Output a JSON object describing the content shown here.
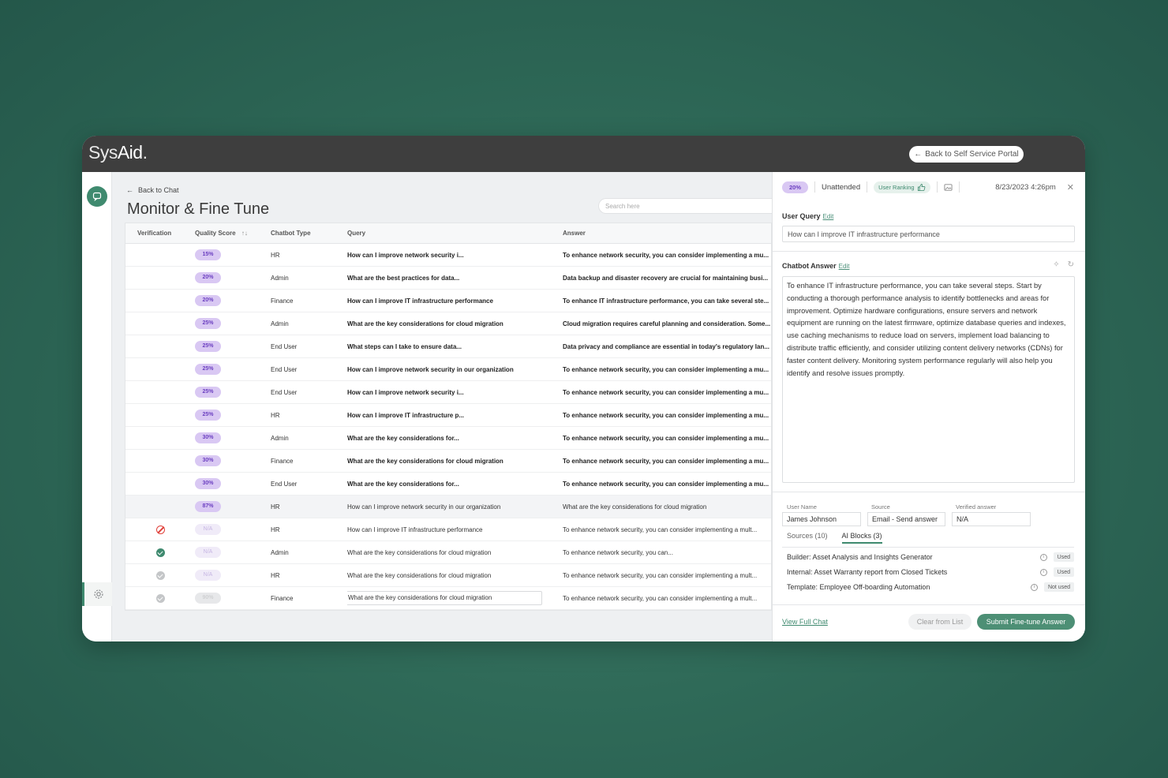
{
  "app": {
    "logo_prefix": "Sys",
    "logo_suffix": "Aid",
    "logo_dot": ".",
    "portal_button": "Back to Self Service Portal"
  },
  "nav": {
    "back_label": "Back to Chat",
    "page_title": "Monitor & Fine Tune",
    "search_placeholder": "Search here"
  },
  "table": {
    "headers": {
      "verification": "Verification",
      "quality": "Quality Score",
      "sort_glyph": "↑↓",
      "type": "Chatbot Type",
      "query": "Query",
      "answer": "Answer"
    },
    "rows": [
      {
        "verification": "",
        "score": "15%",
        "type": "HR",
        "query": "How can I improve network security i...",
        "answer": "To enhance network security, you can consider implementing a mu..."
      },
      {
        "verification": "",
        "score": "20%",
        "type": "Admin",
        "query": "What are the best practices for data...",
        "answer": "Data backup and disaster recovery are crucial for maintaining busi..."
      },
      {
        "verification": "",
        "score": "20%",
        "type": "Finance",
        "query": "How can I improve IT infrastructure performance",
        "answer": "To enhance IT infrastructure performance, you can take several ste..."
      },
      {
        "verification": "",
        "score": "25%",
        "type": "Admin",
        "query": "What are the key considerations for cloud migration",
        "answer": "Cloud migration requires careful planning and consideration. Some..."
      },
      {
        "verification": "",
        "score": "25%",
        "type": "End User",
        "query": "What steps can I take to ensure data...",
        "answer": "Data privacy and compliance are essential in today's regulatory lan..."
      },
      {
        "verification": "",
        "score": "25%",
        "type": "End User",
        "query": "How can I improve network security in our organization",
        "answer": "To enhance network security, you can consider implementing a mu..."
      },
      {
        "verification": "",
        "score": "25%",
        "type": "End User",
        "query": "How can I improve network security i...",
        "answer": "To enhance network security, you can consider implementing a mu..."
      },
      {
        "verification": "",
        "score": "25%",
        "type": "HR",
        "query": "How can I improve IT infrastructure p...",
        "answer": "To enhance network security, you can consider implementing a mu..."
      },
      {
        "verification": "",
        "score": "30%",
        "type": "Admin",
        "query": "What are the key considerations for...",
        "answer": "To enhance network security, you can consider implementing a mu..."
      },
      {
        "verification": "",
        "score": "30%",
        "type": "Finance",
        "query": "What are the key considerations for cloud migration",
        "answer": "To enhance network security, you can consider implementing a mu..."
      },
      {
        "verification": "",
        "score": "30%",
        "type": "End User",
        "query": "What are the key considerations for...",
        "answer": "To enhance network security, you can consider implementing a mu..."
      },
      {
        "verification": "",
        "score": "87%",
        "type": "HR",
        "query": "How can I improve network security in our organization",
        "answer": "What are the key considerations for cloud migration"
      },
      {
        "verification": "blocked",
        "score": "N/A",
        "type": "HR",
        "query": "How can I improve IT infrastructure performance",
        "answer": "To enhance network security, you can consider implementing a mult..."
      },
      {
        "verification": "verified",
        "score": "N/A",
        "type": "Admin",
        "query": "What are the key considerations for cloud migration",
        "answer": "To enhance network security, you can..."
      },
      {
        "verification": "pending",
        "score": "N/A",
        "type": "HR",
        "query": "What are the key considerations for cloud migration",
        "answer": "To enhance network security, you can consider implementing a mult..."
      },
      {
        "verification": "pending",
        "score": "90%",
        "type": "Finance",
        "query": "What are the key considerations for cloud migration",
        "answer": "To enhance network security, you can consider implementing a mult..."
      }
    ]
  },
  "panel": {
    "score": "20%",
    "status": "Unattended",
    "ranking_label": "User Ranking",
    "datetime": "8/23/2023 4:26pm",
    "user_query_label": "User Query",
    "edit_label": "Edit",
    "user_query": "How can I improve IT infrastructure performance",
    "answer_label": "Chatbot Answer",
    "answer": "To enhance IT infrastructure performance, you can take several steps. Start by conducting a thorough performance analysis to identify bottlenecks and areas for improvement. Optimize hardware configurations, ensure servers and network equipment are running on the latest firmware, optimize database queries and indexes, use caching mechanisms to reduce load on servers, implement load balancing to distribute traffic efficiently, and consider utilizing content delivery networks (CDNs) for faster content delivery. Monitoring system performance regularly will also help you identify and resolve issues promptly.",
    "user_name_label": "User Name",
    "user_name": "James Johnson",
    "source_label": "Source",
    "source": "Email - Send answer",
    "verified_label": "Verified answer",
    "verified": "N/A",
    "tab_sources": "Sources (10)",
    "tab_blocks": "AI Blocks (3)",
    "blocks": [
      {
        "name": "Builder: Asset Analysis and Insights Generator",
        "status": "Used"
      },
      {
        "name": "Internal: Asset Warranty report from Closed Tickets",
        "status": "Used"
      },
      {
        "name": "Template: Employee Off-boarding Automation",
        "status": "Not used"
      }
    ],
    "view_full_chat": "View Full Chat",
    "clear_button": "Clear from List",
    "submit_button": "Submit Fine-tune Answer"
  },
  "colors": {
    "accent": "#3f8a6f",
    "score_pill": "#d9c8f3",
    "topbar": "#3e3e3e"
  }
}
